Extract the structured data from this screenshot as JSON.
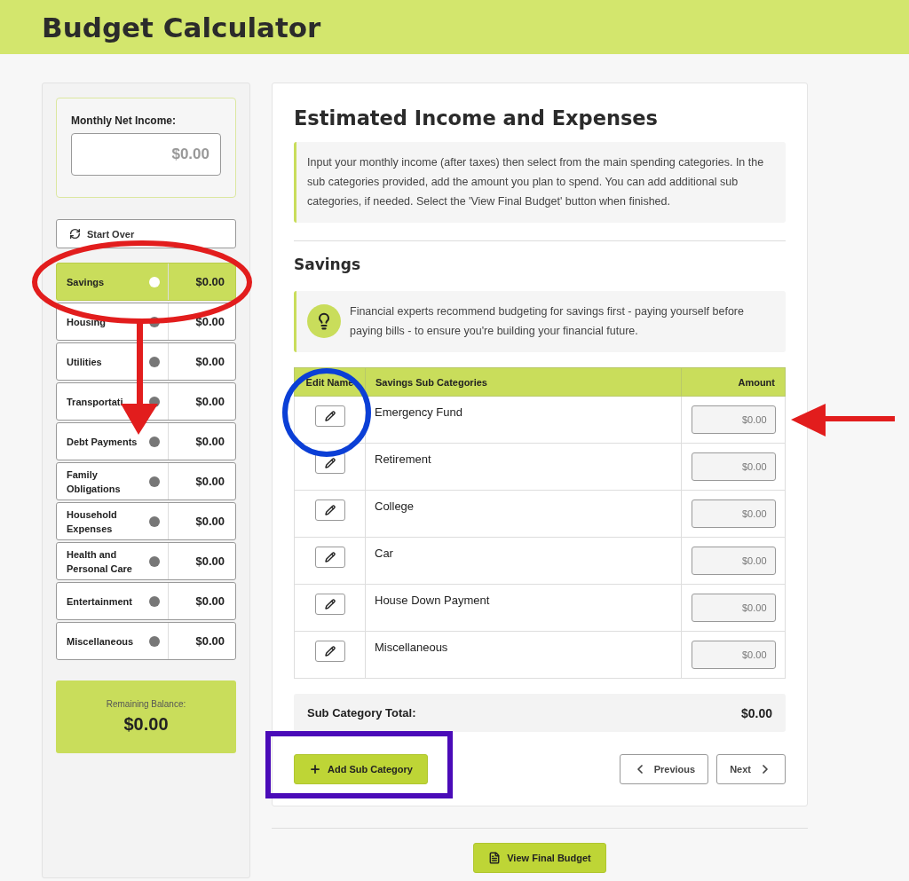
{
  "header": {
    "title": "Budget Calculator"
  },
  "sidebar": {
    "income_label": "Monthly Net Income:",
    "income_placeholder": "$0.00",
    "start_over": "Start Over",
    "categories": [
      {
        "name": "Savings",
        "amount": "$0.00",
        "selected": true
      },
      {
        "name": "Housing",
        "amount": "$0.00",
        "selected": false
      },
      {
        "name": "Utilities",
        "amount": "$0.00",
        "selected": false
      },
      {
        "name": "Transportati",
        "amount": "$0.00",
        "selected": false
      },
      {
        "name": "Debt Payments",
        "amount": "$0.00",
        "selected": false
      },
      {
        "name": "Family Obligations",
        "amount": "$0.00",
        "selected": false
      },
      {
        "name": "Household Expenses",
        "amount": "$0.00",
        "selected": false
      },
      {
        "name": "Health and Personal Care",
        "amount": "$0.00",
        "selected": false
      },
      {
        "name": "Entertainment",
        "amount": "$0.00",
        "selected": false
      },
      {
        "name": "Miscellaneous",
        "amount": "$0.00",
        "selected": false
      }
    ],
    "remaining_label": "Remaining Balance:",
    "remaining_value": "$0.00"
  },
  "main": {
    "title": "Estimated Income and Expenses",
    "intro": "Input your monthly income (after taxes) then select from the main spending categories. In the sub categories provided, add the amount you plan to spend. You can add additional sub categories, if needed. Select the 'View Final Budget' button when finished.",
    "section_title": "Savings",
    "tip": "Financial experts recommend budgeting for savings first - paying yourself before paying bills - to ensure you're building your financial future.",
    "table": {
      "columns": [
        "Edit Name",
        "Savings Sub Categories",
        "Amount"
      ],
      "rows": [
        {
          "name": "Emergency Fund",
          "placeholder": "$0.00"
        },
        {
          "name": "Retirement",
          "placeholder": "$0.00"
        },
        {
          "name": "College",
          "placeholder": "$0.00"
        },
        {
          "name": "Car",
          "placeholder": "$0.00"
        },
        {
          "name": "House Down Payment",
          "placeholder": "$0.00"
        },
        {
          "name": "Miscellaneous",
          "placeholder": "$0.00"
        }
      ]
    },
    "total_label": "Sub Category Total:",
    "total_value": "$0.00",
    "add_button": "Add Sub Category",
    "previous_button": "Previous",
    "next_button": "Next"
  },
  "footer": {
    "final_button": "View Final Budget"
  },
  "annotations": [
    {
      "kind": "ellipse",
      "color": "#e21d1d"
    },
    {
      "kind": "arrow-down",
      "color": "#e21d1d"
    },
    {
      "kind": "circle",
      "color": "#0b3fd6"
    },
    {
      "kind": "arrow-left",
      "color": "#e21d1d"
    },
    {
      "kind": "frame",
      "color": "#4a0bb8"
    }
  ]
}
